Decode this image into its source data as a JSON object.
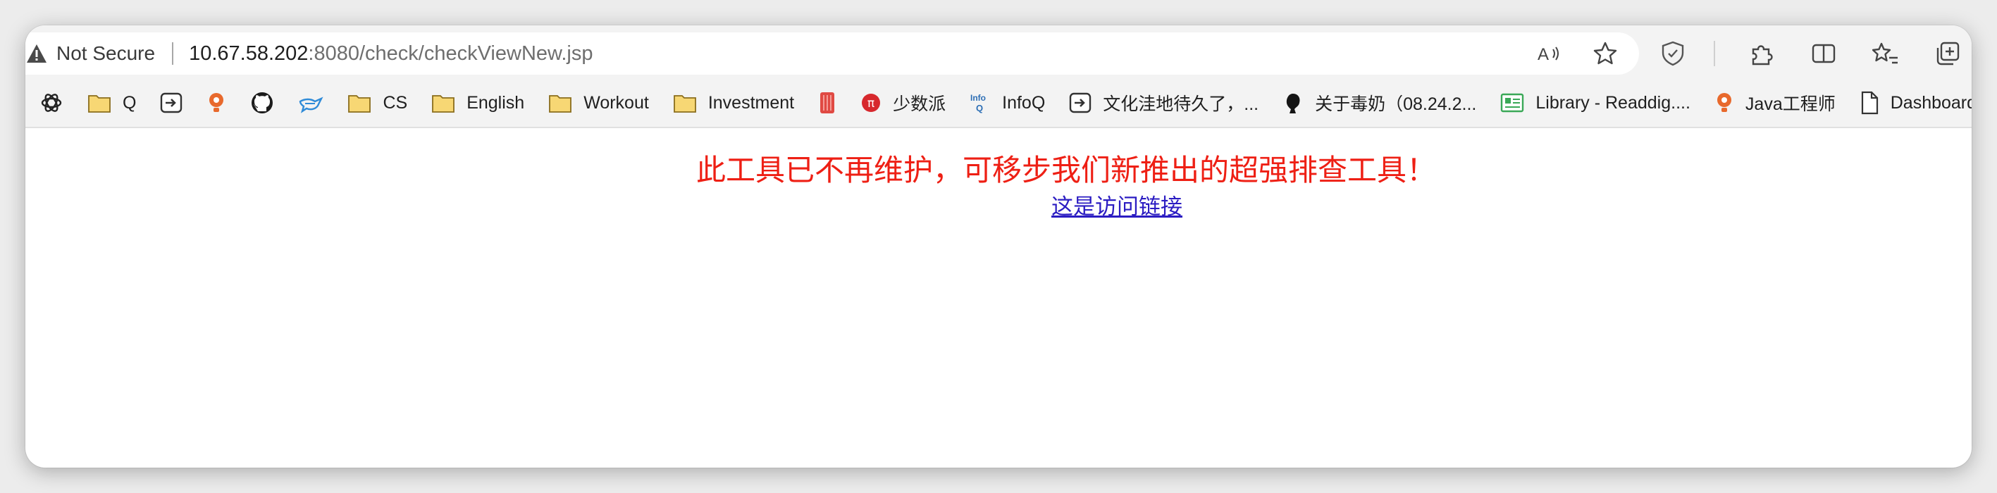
{
  "address_bar": {
    "security_label": "Not Secure",
    "url_host": "10.67.58.202",
    "url_rest": ":8080/check/checkViewNew.jsp",
    "icons": [
      "read-aloud-icon",
      "favorite-star-icon"
    ]
  },
  "toolbar": {
    "icons": [
      "shield-icon",
      "extensions-icon",
      "split-screen-icon",
      "favorites-icon",
      "collections-icon"
    ]
  },
  "bookmarks": [
    {
      "icon": "openai-icon",
      "label": ""
    },
    {
      "icon": "folder-icon",
      "label": "Q"
    },
    {
      "icon": "arrow-box-icon",
      "label": ""
    },
    {
      "icon": "bulb-icon",
      "label": ""
    },
    {
      "icon": "github-icon",
      "label": ""
    },
    {
      "icon": "bird-icon",
      "label": ""
    },
    {
      "icon": "folder-icon",
      "label": "CS"
    },
    {
      "icon": "folder-icon",
      "label": "English"
    },
    {
      "icon": "folder-icon",
      "label": "Workout"
    },
    {
      "icon": "folder-icon",
      "label": "Investment"
    },
    {
      "icon": "red-book-icon",
      "label": ""
    },
    {
      "icon": "pi-icon",
      "label": "少数派"
    },
    {
      "icon": "infoq-icon",
      "label": "InfoQ"
    },
    {
      "icon": "arrow-box-icon",
      "label": "文化洼地待久了，..."
    },
    {
      "icon": "avatar-icon",
      "label": "关于毒奶（08.24.2..."
    },
    {
      "icon": "library-icon",
      "label": "Library - Readdig...."
    },
    {
      "icon": "bulb-icon",
      "label": "Java工程师"
    },
    {
      "icon": "page-icon",
      "label": "Dashboard"
    }
  ],
  "page": {
    "notice": "此工具已不再维护，可移步我们新推出的超强排查工具！",
    "link_text": "这是访问链接",
    "notice_color": "#ee1f14",
    "link_color": "#2b1cc2"
  }
}
